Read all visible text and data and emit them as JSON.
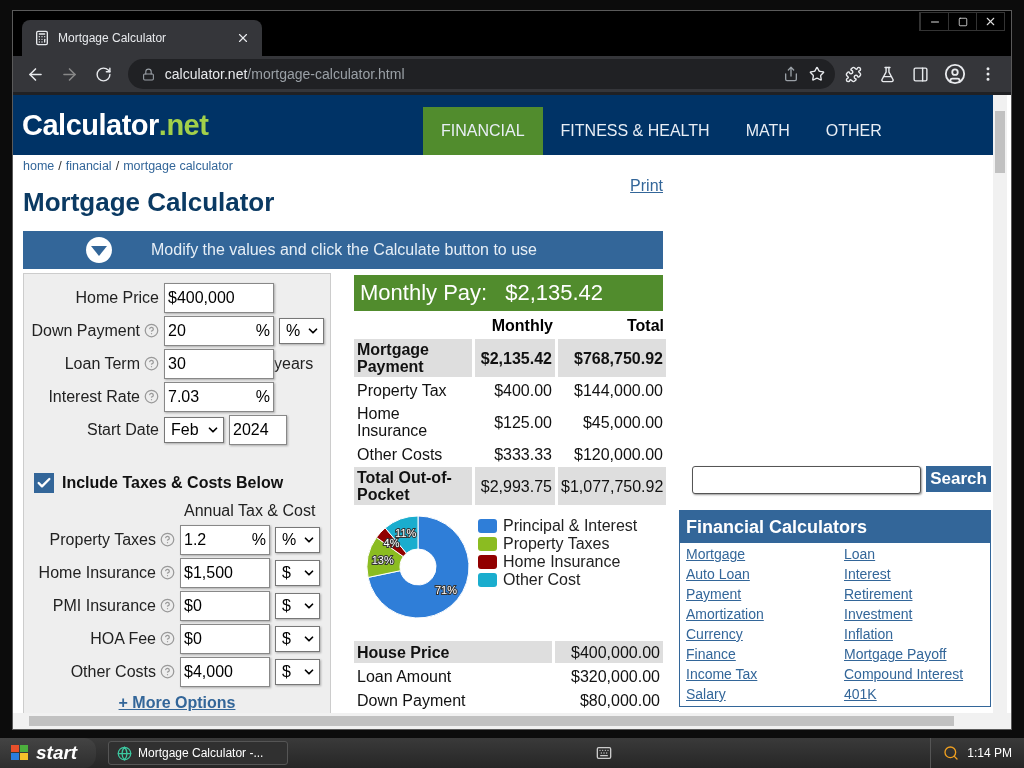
{
  "browser": {
    "tab_title": "Mortgage Calculator",
    "url_host": "calculator.net",
    "url_path": "/mortgage-calculator.html"
  },
  "site": {
    "logo_main": "Calculator",
    "logo_suffix": ".net",
    "nav": [
      {
        "label": "FINANCIAL",
        "selected": true
      },
      {
        "label": "FITNESS & HEALTH",
        "selected": false
      },
      {
        "label": "MATH",
        "selected": false
      },
      {
        "label": "OTHER",
        "selected": false
      }
    ]
  },
  "breadcrumb": {
    "separator": "/",
    "items": [
      "home",
      "financial",
      "mortgage calculator"
    ]
  },
  "title": "Mortgage Calculator",
  "print_link": "Print",
  "banner": "Modify the values and click the Calculate button to use",
  "form": {
    "fields": [
      {
        "kind": "text",
        "label": "Home Price",
        "help": false,
        "value": "$400,000"
      },
      {
        "kind": "text",
        "label": "Down Payment",
        "help": true,
        "value": "20",
        "suffix": "%",
        "unit": "%"
      },
      {
        "kind": "text",
        "label": "Loan Term",
        "help": true,
        "value": "30",
        "after": "years"
      },
      {
        "kind": "text",
        "label": "Interest Rate",
        "help": true,
        "value": "7.03",
        "suffix": "%"
      },
      {
        "kind": "date",
        "label": "Start Date",
        "help": false,
        "month": "Feb",
        "value": "2024"
      }
    ],
    "include_taxes": {
      "label": "Include Taxes & Costs Below",
      "checked": true
    },
    "annual_header": "Annual Tax & Cost",
    "cost_fields": [
      {
        "label": "Property Taxes",
        "value": "1.2",
        "suffix": "%",
        "unit": "%"
      },
      {
        "label": "Home Insurance",
        "value": "$1,500",
        "unit": "$"
      },
      {
        "label": "PMI Insurance",
        "value": "$0",
        "unit": "$"
      },
      {
        "label": "HOA Fee",
        "value": "$0",
        "unit": "$"
      },
      {
        "label": "Other Costs",
        "value": "$4,000",
        "unit": "$"
      }
    ],
    "more_options": "+ More Options"
  },
  "results": {
    "monthly_pay": {
      "label": "Monthly Pay:",
      "value": "$2,135.42"
    },
    "columns": [
      "Monthly",
      "Total"
    ],
    "rows": [
      {
        "label": "Mortgage Payment",
        "monthly": "$2,135.42",
        "total": "$768,750.92",
        "highlight": true,
        "bold_values": true
      },
      {
        "label": "Property Tax",
        "monthly": "$400.00",
        "total": "$144,000.00",
        "highlight": false,
        "bold_values": false
      },
      {
        "label": "Home Insurance",
        "monthly": "$125.00",
        "total": "$45,000.00",
        "highlight": false,
        "bold_values": false
      },
      {
        "label": "Other Costs",
        "monthly": "$333.33",
        "total": "$120,000.00",
        "highlight": false,
        "bold_values": false
      },
      {
        "label": "Total Out-of-Pocket",
        "monthly": "$2,993.75",
        "total": "$1,077,750.92",
        "highlight": true,
        "bold_values": false
      }
    ],
    "chart_data": {
      "type": "donut",
      "categories": [
        "Principal & Interest",
        "Property Taxes",
        "Home Insurance",
        "Other Cost"
      ],
      "values": [
        71,
        13,
        4,
        11
      ],
      "legend": "right",
      "colors": [
        "#2f7ed8",
        "#8bbc21",
        "#910000",
        "#1aadce"
      ],
      "value_labels": [
        "71%",
        "13%",
        "4%",
        "11%"
      ]
    },
    "summary": [
      {
        "label": "House Price",
        "value": "$400,000.00",
        "highlight": true
      },
      {
        "label": "Loan Amount",
        "value": "$320,000.00",
        "highlight": false
      },
      {
        "label": "Down Payment",
        "value": "$80,000.00",
        "highlight": false
      }
    ]
  },
  "sidebar": {
    "search_button": "Search",
    "panel_title": "Financial Calculators",
    "links": [
      "Mortgage",
      "Loan",
      "Auto Loan",
      "Interest",
      "Payment",
      "Retirement",
      "Amortization",
      "Investment",
      "Currency",
      "Inflation",
      "Finance",
      "Mortgage Payoff",
      "Income Tax",
      "Compound Interest",
      "Salary",
      "401K"
    ]
  },
  "taskbar": {
    "start": "start",
    "task": "Mortgage Calculator -...",
    "clock": "1:14 PM"
  }
}
